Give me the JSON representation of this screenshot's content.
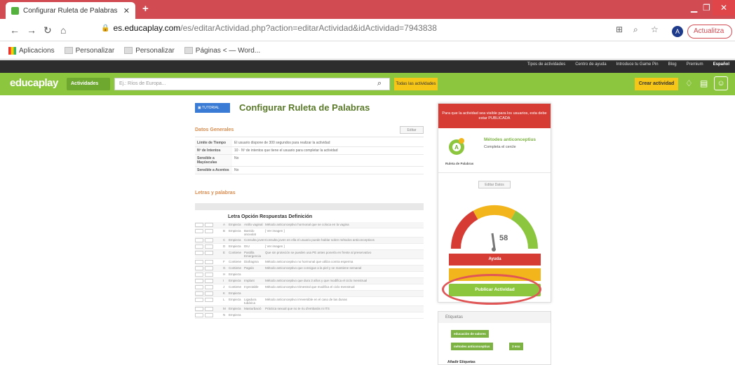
{
  "browser": {
    "tab_title": "Configurar Ruleta de Palabras - E",
    "url_host": "es.educaplay.com",
    "url_path": "/es/editarActividad.php?action=editarActividad&idActividad=7943838",
    "profile_initial": "A",
    "update_label": "Actualitza",
    "bookmarks": [
      "Aplicacions",
      "Personalizar",
      "Personalizar",
      "Páginas < — Word..."
    ]
  },
  "site": {
    "top_links": [
      "Tipos de actividades",
      "Centro de ayuda",
      "Introduce tu Game Pin",
      "Blog",
      "Premium"
    ],
    "language": "Español",
    "logo": "educaplay",
    "activities_btn": "Actividades",
    "search_placeholder": "Ej.: Ríos de Europa...",
    "all_activities_btn": "Todas las actividades",
    "create_btn": "Crear actividad"
  },
  "main": {
    "tutorial_btn": "TUTORIAL",
    "title": "Configurar Ruleta de Palabras",
    "general_heading": "Datos Generales",
    "edit_btn": "Editar",
    "general_rows": [
      {
        "k": "Límite de Tiempo",
        "v": "El usuario dispone de 300 segundos para realizar la actividad"
      },
      {
        "k": "Nº de Intentos",
        "v": "10 · Nº de intentos que tiene el usuario para completar la actividad"
      },
      {
        "k": "Sensible a Mayúsculas",
        "v": "No"
      },
      {
        "k": "Sensible a Acentos",
        "v": "No"
      }
    ],
    "letters_heading": "Letras y palabras",
    "columns": "Letra Opción Respuestas Definición",
    "letter_rows": [
      {
        "l": "A",
        "o": "Empieza",
        "a": "Anillo vaginal",
        "d": "Método anticonceptivo hormonal que se coloca en la vagina"
      },
      {
        "l": "B",
        "o": "Empieza",
        "a": "Barrido anovulat",
        "d": "[ Ver imagen ]"
      },
      {
        "l": "C",
        "o": "Empieza",
        "a": "Consulta joven",
        "d": "Consulta joven en ella el usuario puede hablar sobre métodos anticonceptivos"
      },
      {
        "l": "D",
        "o": "Empieza",
        "a": "DIU",
        "d": "[ Ver imagen ]"
      },
      {
        "l": "E",
        "o": "Contiene",
        "a": "Pastilla Emergencia",
        "d": "Que sin proteción se pueden usa PE antes ponerla en frente al preservativo"
      },
      {
        "l": "F",
        "o": "Contiene",
        "a": "Diafragma",
        "d": "Método anticonceptivo no hormonal que utiliza contra esperma"
      },
      {
        "l": "G",
        "o": "Contiene",
        "a": "Pagalo",
        "d": "Método anticonceptivo que consigue a la piel y se mantiene semanal"
      },
      {
        "l": "H",
        "o": "Empieza",
        "a": "",
        "d": ""
      },
      {
        "l": "I",
        "o": "Empieza",
        "a": "Implant",
        "d": "Método anticonceptivo que dura 3 años y que modifica el ciclo menstrual"
      },
      {
        "l": "J",
        "o": "Contiene",
        "a": "Inyectable",
        "d": "Método anticonceptivo trimestral que modifica el ciclo menstrual"
      },
      {
        "l": "K",
        "o": "Empieza",
        "a": "",
        "d": ""
      },
      {
        "l": "L",
        "o": "Empieza",
        "a": "Ligadura tubárica",
        "d": "Método anticonceptivo irreversible en el caso de las dunas"
      },
      {
        "l": "M",
        "o": "Empieza",
        "a": "Masturbació",
        "d": "Práctica sexual que no te riu d'embaràs ni ITS"
      },
      {
        "l": "N",
        "o": "Empieza",
        "a": "",
        "d": ""
      }
    ]
  },
  "panel": {
    "banner": "Para que la actividad sea visible para los usuarios, esta debe estar PUBLICADA",
    "activity_name": "Métodes anticonceptius",
    "activity_sub": "Completa el cercle",
    "activity_type": "Ruleta de Palabras",
    "edit_data_btn": "Editar Datos",
    "gauge_value": "58",
    "help_btn": "Ayuda",
    "publish_btn": "Publicar Actividad",
    "tags_heading": "Etiquetas",
    "tags": [
      "educación de valores",
      "métodes anticonceptius",
      "3 eso"
    ],
    "add_tags": "Añadir Etiquetas"
  },
  "colors": {
    "green": "#8cc63f",
    "red": "#d63b34",
    "yellow": "#f2b51c",
    "chrome_red": "#d14b53"
  }
}
